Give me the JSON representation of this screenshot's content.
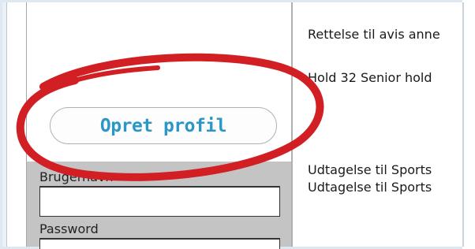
{
  "sidebar": {
    "create_profile_button": "Opret profil",
    "username_label": "Brugernavn",
    "username_value": "",
    "password_label": "Password",
    "password_value": ""
  },
  "news": {
    "items": [
      "Rettelse til avis anne",
      "Hold 32 Senior hold",
      "Udtagelse til Sports",
      "Udtagelse til Sports"
    ]
  },
  "annotation": {
    "color": "#d11f24",
    "shape": "ellipse"
  }
}
